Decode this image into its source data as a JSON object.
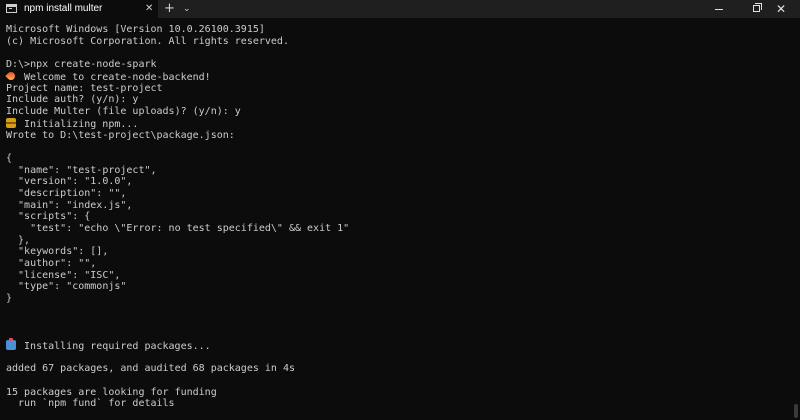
{
  "window": {
    "tab_title": "npm install multer",
    "tab_close_glyph": "✕",
    "new_tab_glyph": "+",
    "tab_dropdown_glyph": "⌄",
    "minimize_icon": "minimize-icon",
    "maximize_icon": "maximize-icon",
    "close_glyph": "✕"
  },
  "terminal": {
    "lines": [
      "Microsoft Windows [Version 10.0.26100.3915]",
      "(c) Microsoft Corporation. All rights reserved.",
      "",
      "D:\\>npx create-node-spark",
      "Welcome to create-node-backend!",
      "Project name: test-project",
      "Include auth? (y/n): y",
      "Include Multer (file uploads)? (y/n): y",
      "Initializing npm...",
      "Wrote to D:\\test-project\\package.json:",
      "",
      "{",
      "  \"name\": \"test-project\",",
      "  \"version\": \"1.0.0\",",
      "  \"description\": \"\",",
      "  \"main\": \"index.js\",",
      "  \"scripts\": {",
      "    \"test\": \"echo \\\"Error: no test specified\\\" && exit 1\"",
      "  },",
      "  \"keywords\": [],",
      "  \"author\": \"\",",
      "  \"license\": \"ISC\",",
      "  \"type\": \"commonjs\"",
      "}",
      "",
      "",
      "",
      "",
      "Installing required packages...",
      "",
      "added 67 packages, and audited 68 packages in 4s",
      "",
      "15 packages are looking for funding",
      "  run `npm fund` for details"
    ],
    "icons": {
      "rocket": "rocket-icon",
      "package": "package-icon",
      "installing": "package-icon"
    }
  },
  "colors": {
    "background": "#0c0c0c",
    "titlebar": "#1f1f1f",
    "text": "#cccccc"
  }
}
